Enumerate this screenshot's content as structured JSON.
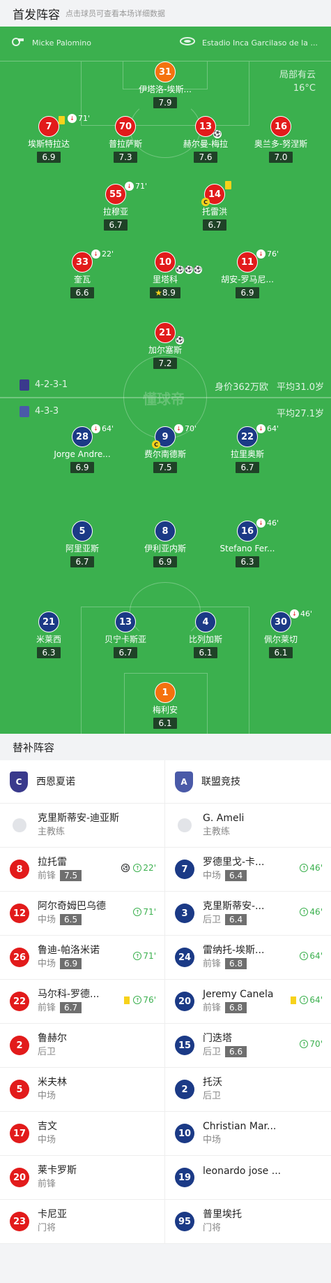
{
  "header": {
    "title": "首发阵容",
    "subtitle": "点击球员可查看本场详细数据"
  },
  "match": {
    "referee": "Micke Palomino",
    "stadium": "Estadio Inca Garcilaso de la ...",
    "weather": "局部有云",
    "temperature": "16°C"
  },
  "home": {
    "formation": "4-2-3-1",
    "value": "身价362万欧",
    "avg_age": "平均31.0岁",
    "color": "#e21b1b"
  },
  "away": {
    "formation": "4-3-3",
    "avg_age": "平均27.1岁",
    "color": "#1b3a86"
  },
  "watermark": "懂球帝",
  "home_players": [
    {
      "num": "31",
      "name": "伊塔洛-埃斯...",
      "rating": "7.9"
    },
    {
      "num": "7",
      "name": "埃斯特拉达",
      "rating": "6.9",
      "sub_min": "71'"
    },
    {
      "num": "70",
      "name": "普拉萨斯",
      "rating": "7.3"
    },
    {
      "num": "13",
      "name": "赫尔曼-梅拉",
      "rating": "7.6"
    },
    {
      "num": "16",
      "name": "奥兰多-努涅斯",
      "rating": "7.0"
    },
    {
      "num": "55",
      "name": "拉穆亚",
      "rating": "6.7",
      "sub_min": "71'"
    },
    {
      "num": "14",
      "name": "托雷洪",
      "rating": "6.7"
    },
    {
      "num": "33",
      "name": "奎瓦",
      "rating": "6.6",
      "sub_min": "22'"
    },
    {
      "num": "10",
      "name": "里塔科",
      "rating": "8.9"
    },
    {
      "num": "11",
      "name": "胡安-罗马尼...",
      "rating": "6.9",
      "sub_min": "76'"
    },
    {
      "num": "21",
      "name": "加尔塞斯",
      "rating": "7.2"
    }
  ],
  "away_players": [
    {
      "num": "28",
      "name": "Jorge Andre...",
      "rating": "6.9",
      "sub_min": "64'"
    },
    {
      "num": "9",
      "name": "费尔南德斯",
      "rating": "7.5",
      "sub_min": "70'"
    },
    {
      "num": "22",
      "name": "拉里奥斯",
      "rating": "6.7",
      "sub_min": "64'"
    },
    {
      "num": "5",
      "name": "阿里亚斯",
      "rating": "6.7"
    },
    {
      "num": "8",
      "name": "伊利亚内斯",
      "rating": "6.9"
    },
    {
      "num": "16",
      "name": "Stefano Fer...",
      "rating": "6.3",
      "sub_min": "46'"
    },
    {
      "num": "21",
      "name": "米莱西",
      "rating": "6.3"
    },
    {
      "num": "13",
      "name": "贝宁卡斯亚",
      "rating": "6.7"
    },
    {
      "num": "4",
      "name": "比列加斯",
      "rating": "6.1"
    },
    {
      "num": "30",
      "name": "佩尔莱切",
      "rating": "6.1",
      "sub_min": "46'"
    },
    {
      "num": "1",
      "name": "梅利安",
      "rating": "6.1"
    }
  ],
  "subs": {
    "title": "替补阵容",
    "home_team": "西恩夏诺",
    "away_team": "联盟竞技",
    "home_coach": {
      "name": "克里斯蒂安-迪亚斯",
      "role": "主教练"
    },
    "away_coach": {
      "name": "G. Ameli",
      "role": "主教练"
    },
    "home": [
      {
        "num": "8",
        "name": "拉托雷",
        "pos": "前锋",
        "rating": "7.5",
        "min": "22'"
      },
      {
        "num": "12",
        "name": "阿尔奇姆巴乌德",
        "pos": "中场",
        "rating": "6.5",
        "min": "71'"
      },
      {
        "num": "26",
        "name": "鲁迪-帕洛米诺",
        "pos": "中场",
        "rating": "6.9",
        "min": "71'"
      },
      {
        "num": "22",
        "name": "马尔科-罗德...",
        "pos": "前锋",
        "rating": "6.7",
        "min": "76'"
      },
      {
        "num": "2",
        "name": "鲁赫尔",
        "pos": "后卫"
      },
      {
        "num": "5",
        "name": "米夫林",
        "pos": "中场"
      },
      {
        "num": "17",
        "name": "吉文",
        "pos": "中场"
      },
      {
        "num": "20",
        "name": "莱卡罗斯",
        "pos": "前锋"
      },
      {
        "num": "23",
        "name": "卡尼亚",
        "pos": "门将"
      }
    ],
    "away": [
      {
        "num": "7",
        "name": "罗德里戈-卡...",
        "pos": "中场",
        "rating": "6.4",
        "min": "46'"
      },
      {
        "num": "3",
        "name": "克里斯蒂安-...",
        "pos": "后卫",
        "rating": "6.4",
        "min": "46'"
      },
      {
        "num": "24",
        "name": "雷纳托-埃斯...",
        "pos": "前锋",
        "rating": "6.8",
        "min": "64'"
      },
      {
        "num": "20",
        "name": "Jeremy Canela",
        "pos": "前锋",
        "rating": "6.8",
        "min": "64'"
      },
      {
        "num": "15",
        "name": "门迭塔",
        "pos": "后卫",
        "rating": "6.6",
        "min": "70'"
      },
      {
        "num": "2",
        "name": "托沃",
        "pos": "后卫"
      },
      {
        "num": "10",
        "name": "Christian Mar...",
        "pos": "中场"
      },
      {
        "num": "19",
        "name": "leonardo jose ..."
      },
      {
        "num": "95",
        "name": "普里埃托",
        "pos": "门将"
      }
    ]
  }
}
